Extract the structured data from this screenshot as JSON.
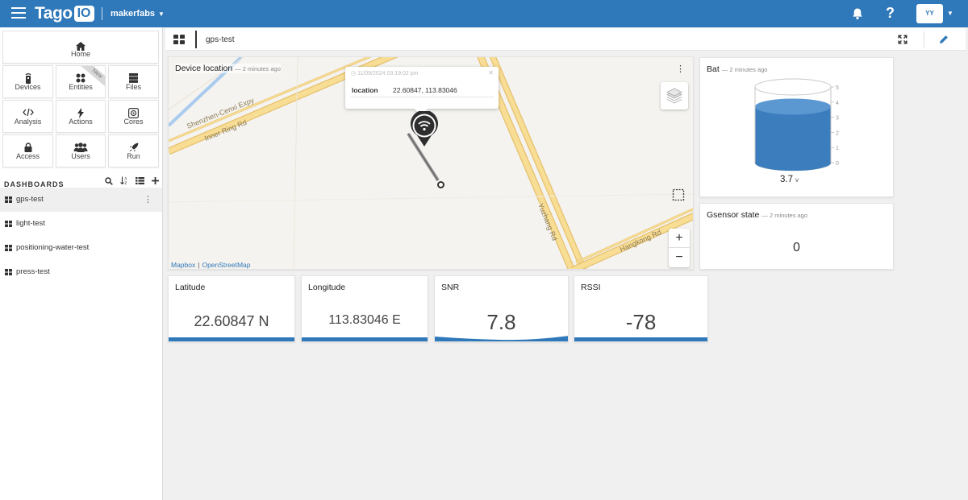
{
  "topbar": {
    "logo_text": "Tago",
    "logo_badge": "IO",
    "account_name": "makerfabs",
    "avatar_text": "YY",
    "help_label": "?"
  },
  "sidebar": {
    "tiles": [
      {
        "label": "Home",
        "icon": "home-icon"
      },
      {
        "label": "Devices",
        "icon": "device-icon"
      },
      {
        "label": "Entities",
        "icon": "entities-icon",
        "badge": "New"
      },
      {
        "label": "Files",
        "icon": "files-icon"
      },
      {
        "label": "Analysis",
        "icon": "code-icon"
      },
      {
        "label": "Actions",
        "icon": "bolt-icon"
      },
      {
        "label": "Cores",
        "icon": "cores-icon"
      },
      {
        "label": "Access",
        "icon": "lock-icon"
      },
      {
        "label": "Users",
        "icon": "users-icon"
      },
      {
        "label": "Run",
        "icon": "rocket-icon"
      }
    ],
    "dashboards_title": "DASHBOARDS",
    "dashboards": [
      {
        "name": "gps-test",
        "active": true
      },
      {
        "name": "light-test",
        "active": false
      },
      {
        "name": "positioning-water-test",
        "active": false
      },
      {
        "name": "press-test",
        "active": false
      }
    ]
  },
  "dashboard": {
    "name": "gps-test"
  },
  "widgets": {
    "map": {
      "title": "Device location",
      "ago": "— 2 minutes ago",
      "popup_time": "11/09/2024 03:19:02 pm",
      "popup_key": "location",
      "popup_value": "22.60847, 113.83046",
      "streets": [
        "Shenzhen-Cenxi Expy",
        "Inner Ring Rd",
        "Yuzhang Rd",
        "Hangkong Rd"
      ],
      "attribution_1": "Mapbox",
      "attribution_sep": "|",
      "attribution_2": "OpenStreetMap",
      "zoom_in": "+",
      "zoom_out": "−"
    },
    "battery": {
      "title": "Bat",
      "ago": "— 2 minutes ago",
      "value": "3.7",
      "unit": "v",
      "level": 3.7,
      "scale": [
        "5",
        "4",
        "3",
        "2",
        "1",
        "0"
      ],
      "max": 5
    },
    "gsensor": {
      "title": "Gsensor state",
      "ago": "— 2 minutes ago",
      "value": "0"
    },
    "metrics": [
      {
        "title": "Latitude",
        "value": "22.60847 N"
      },
      {
        "title": "Longitude",
        "value": "113.83046 E"
      },
      {
        "title": "SNR",
        "value": "7.8"
      },
      {
        "title": "RSSI",
        "value": "-78"
      }
    ]
  },
  "colors": {
    "brand": "#2f78b9",
    "road": "#f7d98e",
    "road_edge": "#e9c170"
  }
}
